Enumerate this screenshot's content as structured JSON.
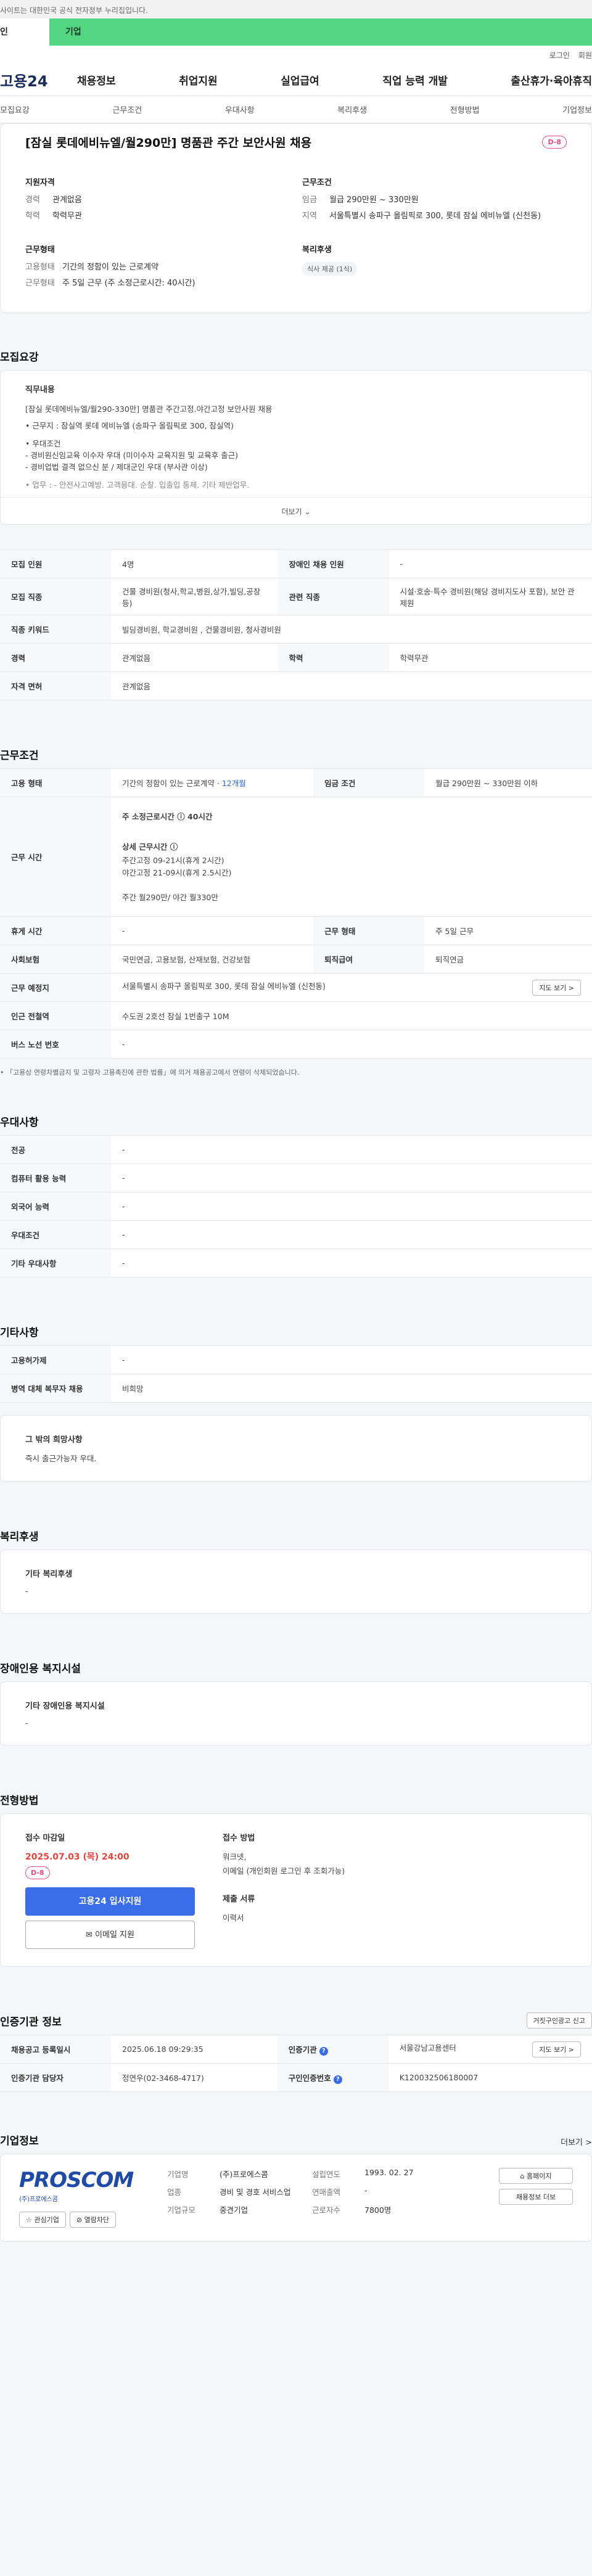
{
  "topbar": {
    "notice": "사이트는 대한민국 공식 전자정부 누리집입니다."
  },
  "user_tabs": {
    "personal": "인",
    "company": "기업"
  },
  "utility": {
    "login": "로그인",
    "signup": "회원"
  },
  "gnb": {
    "logo": "고용24",
    "menu": [
      "채용정보",
      "취업지원",
      "실업급여",
      "직업 능력 개발",
      "출산휴가·육아휴직"
    ]
  },
  "subnav": {
    "items": [
      "모집요강",
      "근무조건",
      "우대사항",
      "복리후생",
      "전형방법",
      "기업정보"
    ]
  },
  "summary": {
    "title": "[잠실 롯데에비뉴엘/월290만] 명품관 주간 보안사원 채용",
    "dday": "D-8",
    "qualification": {
      "title": "지원자격",
      "rows": [
        {
          "k": "경력",
          "v": "관계없음"
        },
        {
          "k": "학력",
          "v": "학력무관"
        }
      ]
    },
    "conditions": {
      "title": "근무조건",
      "rows": [
        {
          "k": "임금",
          "v": "월급 290만원 ~ 330만원"
        },
        {
          "k": "지역",
          "v": "서울특별시 송파구 올림픽로 300, 롯데 잠실 에비뉴엘 (신천동)"
        }
      ]
    },
    "employment": {
      "title": "근무형태",
      "rows": [
        {
          "k": "고용형태",
          "v": "기간의 정함이 있는 근로계약"
        },
        {
          "k": "근무형태",
          "v": "주 5일 근무 (주 소정근로시간: 40시간)"
        }
      ]
    },
    "welfare": {
      "title": "복리후생",
      "chip": "식사 제공 (1식)"
    }
  },
  "recruit": {
    "section_title": "모집요강",
    "detail_title": "직무내용",
    "detail_lines": [
      "[잠실 롯데에비뉴엘/월290-330만] 명품관 주간고정.야간고정 보안사원 채용",
      "• 근무지 : 잠실역 롯데 에비뉴엘 (송파구 올림픽로 300,  잠실역)",
      "• 우대조건",
      "- 경비원신임교육 이수자 우대 (미이수자 교육지원 및 교육후 출근)",
      "- 경비업법 결격 없으신 분 / 제대군인 우대 (부사관 이상)",
      "• 업무 : - 안전사고예방. 고객응대. 순찰. 입출입 통제. 기타 제반업무."
    ],
    "more": "더보기",
    "table": [
      {
        "k1": "모집 인원",
        "v1": "4명",
        "k2": "장애인 채용 인원",
        "v2": "-"
      },
      {
        "k1": "모집 직종",
        "v1": "건물 경비원(청사,학교,병원,상가,빌딩,공장 등)",
        "k2": "관련 직종",
        "v2": "시설·호송·특수 경비원(해당 경비지도사 포함), 보안 관제원"
      },
      {
        "k1": "직종 키워드",
        "v1": "빌딩경비원, 학교경비원 , 건물경비원, 청사경비원",
        "k2": "",
        "v2": ""
      },
      {
        "k1": "경력",
        "v1": "관계없음",
        "k2": "학력",
        "v2": "학력무관"
      },
      {
        "k1": "자격 면허",
        "v1": "관계없음",
        "k2": "",
        "v2": ""
      }
    ]
  },
  "work": {
    "section_title": "근무조건",
    "employment_type_label": "고용 형태",
    "employment_type_value": "기간의 정함이 있는 근로계약 · ",
    "employment_type_period": "12개월",
    "wage_label": "임금 조건",
    "wage_value": "월급 290만원 ~ 330만원 이하",
    "hours_label": "근무 시간",
    "hours_main": "주 소정근로시간 ⓘ 40시간",
    "hours_detail_title": "상세 근무시간 ⓘ",
    "hours_lines": [
      "주간고정 09-21시(휴게 2시간)",
      "야간고정 21-09시(휴게 2.5시간)",
      "",
      "주간 월290만/ 야간 월330만"
    ],
    "rows": [
      {
        "k1": "휴게 시간",
        "v1": "-",
        "k2": "근무 형태",
        "v2": "주 5일 근무"
      },
      {
        "k1": "사회보험",
        "v1": "국민연금, 고용보험, 산재보험, 건강보험",
        "k2": "퇴직급여",
        "v2": "퇴직연금"
      }
    ],
    "location_label": "근무 예정지",
    "location_value": "서울특별시 송파구 올림픽로 300, 롯데 잠실 에비뉴엘 (신천동)",
    "map_button": "지도 보기 >",
    "station_label": "인근 전철역",
    "station_value": "수도권 2호선 잠실 1번출구 10M",
    "bus_label": "버스 노선 번호",
    "bus_value": "-",
    "note": "• 「고용상 연령차별금지 및 고령자 고용촉진에 관한 법률」에 의거 채용공고에서 연령이 삭제되었습니다."
  },
  "preference": {
    "section_title": "우대사항",
    "rows": [
      {
        "k": "전공",
        "v": "-"
      },
      {
        "k": "컴퓨터 활용 능력",
        "v": "-"
      },
      {
        "k": "외국어 능력",
        "v": "-"
      },
      {
        "k": "우대조건",
        "v": "-"
      },
      {
        "k": "기타 우대사항",
        "v": "-"
      }
    ]
  },
  "etc": {
    "section_title": "기타사항",
    "rows": [
      {
        "k": "고용허가제",
        "v": "-"
      },
      {
        "k": "병역 대체 복무자 채용",
        "v": "비희망"
      }
    ],
    "wish_title": "그 밖의 희망사항",
    "wish_value": "즉시 출근가능자 우대."
  },
  "welfare": {
    "section_title": "복리후생",
    "box_title": "기타 복리후생",
    "box_value": "-"
  },
  "disabled": {
    "section_title": "장애인용 복지시설",
    "box_title": "기타 장애인용 복지시설",
    "box_value": "-"
  },
  "screening": {
    "section_title": "전형방법",
    "deadline_label": "접수 마감일",
    "deadline_value": "2025.07.03 (목) 24:00",
    "dday": "D-8",
    "apply_button": "고용24 입사지원",
    "email_button": "✉ 이메일 지원",
    "method_label": "접수 방법",
    "method_lines": [
      "워크넷,",
      "이메일 (개인회원 로그인 후 조회가능)"
    ],
    "docs_label": "제출 서류",
    "docs_value": "이력서"
  },
  "cert": {
    "section_title": "인증기관 정보",
    "report_button": "거짓구인광고 신고",
    "rows": [
      {
        "k1": "채용공고 등록일시",
        "v1": "2025.06.18 09:29:35",
        "k2": "인증기관",
        "v2": "서울강남고용센터"
      },
      {
        "k1": "인증기관 담당자",
        "v1": "정연우(02-3468-4717)",
        "k2": "구인인증번호",
        "v2": "K120032506180007"
      }
    ],
    "map_button": "지도 보기 >"
  },
  "company": {
    "section_title": "기업정보",
    "more": "더보기 >",
    "logo_text": "PROSCOM",
    "logo_sub": "(주)프로에스콤",
    "fav_button": "☆ 관심기업",
    "hide_button": "⊘ 열람차단",
    "info": [
      {
        "k": "기업명",
        "v": "(주)프로에스콤",
        "k2": "설립연도",
        "v2": "1993. 02. 27"
      },
      {
        "k": "업종",
        "v": "경비 및 경호 서비스업",
        "k2": "연매출액",
        "v2": "-"
      },
      {
        "k": "기업규모",
        "v": "중견기업",
        "k2": "근로자수",
        "v2": "7800명"
      }
    ],
    "home_button": "⌂ 홈페이지",
    "more_jobs_button": "채용정보 더보"
  }
}
